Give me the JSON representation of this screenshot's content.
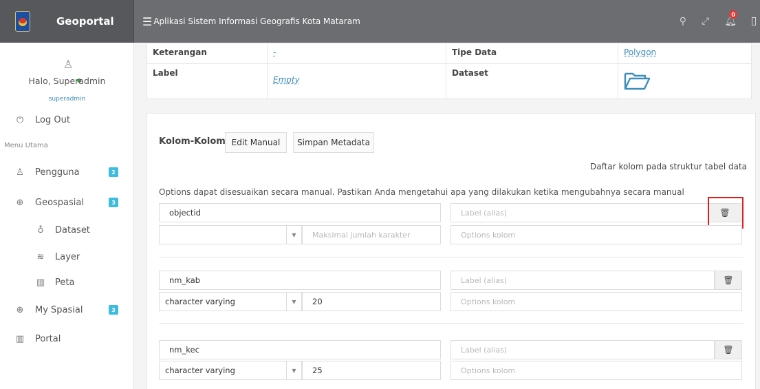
{
  "header": {
    "brand": "Geoportal",
    "app_title": "Aplikasi Sistem Informasi Geografis Kota Mataram",
    "notification_count": "0"
  },
  "sidebar": {
    "greeting": "Halo, Superadmin",
    "username": "superadmin",
    "logout": "Log Out",
    "menu_header": "Menu Utama",
    "items": [
      {
        "label": "Pengguna",
        "count": "2"
      },
      {
        "label": "Geospasial",
        "count": "3"
      },
      {
        "label": "Dataset"
      },
      {
        "label": "Layer"
      },
      {
        "label": "Peta"
      },
      {
        "label": "My Spasial",
        "count": "3"
      },
      {
        "label": "Portal"
      }
    ]
  },
  "info": {
    "keterangan_label": "Keterangan",
    "keterangan_value": "-",
    "tipe_data_label": "Tipe Data",
    "tipe_data_value": "Polygon",
    "label_label": "Label",
    "label_value": "Empty",
    "dataset_label": "Dataset"
  },
  "columns_panel": {
    "heading": "Kolom-Kolom",
    "edit_manual": "Edit Manual",
    "simpan_metadata": "Simpan Metadata",
    "hint_right": "Daftar kolom pada struktur tabel data",
    "options_text": "Options dapat disesuaikan secara manual. Pastikan Anda mengetahui apa yang dilakukan ketika mengubahnya secara manual",
    "placeholders": {
      "label_alias": "Label (alias)",
      "max_chars": "Maksimal jumlah karakter",
      "options": "Options kolom"
    },
    "rows": [
      {
        "name": "objectid",
        "type": "",
        "length": ""
      },
      {
        "name": "nm_kab",
        "type": "character varying",
        "length": "20"
      },
      {
        "name": "nm_kec",
        "type": "character varying",
        "length": "25"
      }
    ]
  },
  "colors": {
    "brand_bg": "#56585b",
    "navbar_bg": "#6b6d71",
    "accent": "#3c8dbc",
    "badge": "#3dbce0",
    "highlight": "#e01e1e"
  }
}
